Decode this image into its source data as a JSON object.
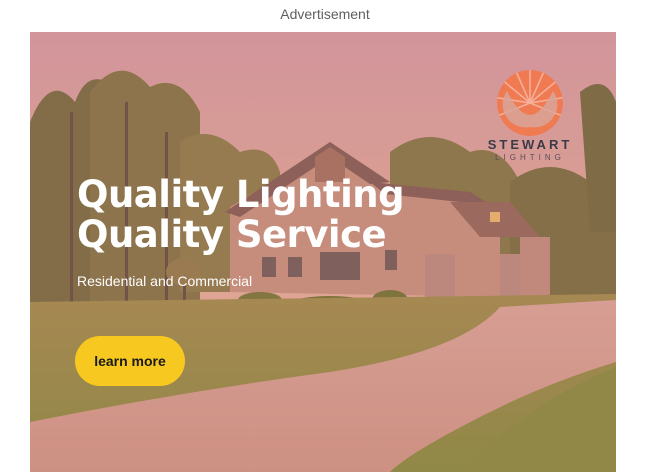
{
  "ad_label": "Advertisement",
  "brand": {
    "name": "STEWART",
    "subtitle": "LIGHTING",
    "logo_icon": "sunrise-logo-icon",
    "logo_color": "#f07a52"
  },
  "headline": {
    "line1": "Quality Lighting",
    "line2": "Quality Service"
  },
  "subheadline": "Residential and Commercial",
  "cta": {
    "label": "learn more",
    "color": "#f7c81f"
  },
  "background_image": "house-exterior-photo"
}
